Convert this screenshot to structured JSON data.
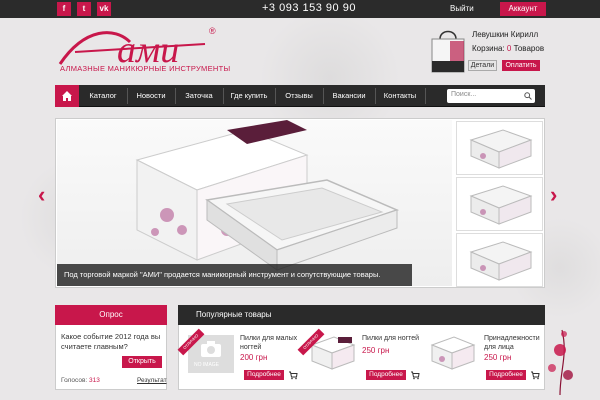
{
  "topbar": {
    "social": [
      {
        "label": "f",
        "icon": "facebook-icon"
      },
      {
        "label": "t",
        "icon": "twitter-icon"
      },
      {
        "label": "vk",
        "icon": "vk-icon"
      }
    ],
    "phone": "+3 093 153 90 90",
    "logout_label": "Выйти",
    "account_label": "Аккаунт"
  },
  "brand": {
    "logo_text": "ами",
    "registered_mark": "®",
    "subtitle": "АЛМАЗНЫЕ МАНИКЮРНЫЕ ИНСТРУМЕНТЫ",
    "accent_color": "#c8174b"
  },
  "cart": {
    "user_name": "Левушкин Кирилл",
    "count_prefix": "Корзина: ",
    "count": "0",
    "count_suffix": " Товаров",
    "details_label": "Детали",
    "pay_label": "Оплатить"
  },
  "nav": {
    "items": [
      "Каталог",
      "Новости",
      "Заточка",
      "Где купить",
      "Отзывы",
      "Вакансии",
      "Контакты"
    ],
    "search_placeholder": "Поиск..."
  },
  "slider": {
    "caption": "Под торговой маркой \"АМИ\" продается маникюрный инструмент и сопутствующие товары."
  },
  "poll": {
    "title": "Опрос",
    "question": "Какое событие 2012 года вы считаете главным?",
    "open_label": "Открыть",
    "votes_label": "Голосов: ",
    "votes_count": "313",
    "results_label": "Результат"
  },
  "popular": {
    "title": "Популярные товары",
    "products": [
      {
        "name": "Пилки для малых ногтей",
        "price": "200 грн",
        "more_label": "Подробнее",
        "ribbon": "ОТЛИЧНО",
        "image": "NO IMAGE"
      },
      {
        "name": "Пилки для ногтей",
        "price": "250 грн",
        "more_label": "Подробнее",
        "ribbon": "ОТЛИЧНО"
      },
      {
        "name": "Принадлежности для лица",
        "price": "250 грн",
        "more_label": "Подробнее"
      }
    ]
  }
}
